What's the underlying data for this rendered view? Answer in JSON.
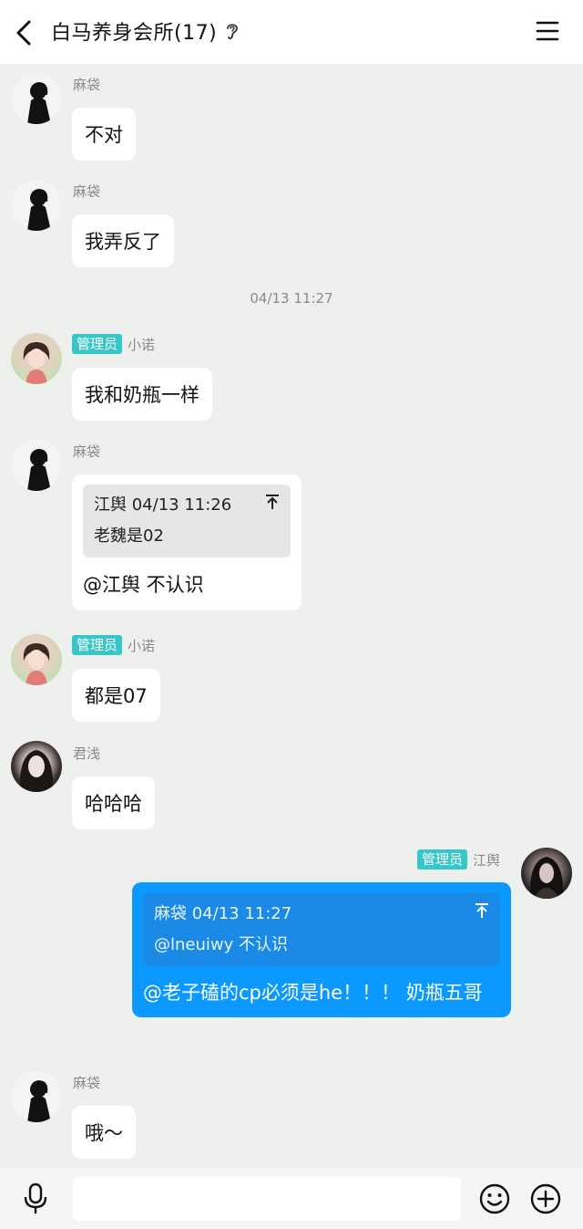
{
  "header": {
    "title": "白马养身会所(17)",
    "back_icon": "chevron-left-icon",
    "ear_icon": "ear-icon",
    "menu_icon": "hamburger-menu-icon"
  },
  "time_separator": "04/13 11:27",
  "messages": [
    {
      "sender": "麻袋",
      "text": "不对"
    },
    {
      "sender": "麻袋",
      "text": "我弄反了"
    },
    {
      "badge": "管理员",
      "sender": "小诺",
      "text": "我和奶瓶一样"
    },
    {
      "sender": "麻袋",
      "quote": {
        "head": "江舆 04/13 11:26",
        "body": "老魏是02",
        "arrow": "⬆"
      },
      "text": "@江舆 不认识"
    },
    {
      "badge": "管理员",
      "sender": "小诺",
      "text": "都是07"
    },
    {
      "sender": "君浅",
      "text": "哈哈哈"
    },
    {
      "badge": "管理员",
      "sender": "江舆",
      "quote": {
        "head": "麻袋 04/13 11:27",
        "body": "@lneuiwy 不认识",
        "arrow": "⬆"
      },
      "text": "@老子磕的cp必须是he！！！ 奶瓶五哥"
    },
    {
      "sender": "麻袋",
      "text": "哦～"
    }
  ],
  "input_bar": {
    "mic_icon": "microphone-icon",
    "emoji_icon": "smiley-icon",
    "plus_icon": "plus-circle-icon",
    "placeholder": ""
  },
  "colors": {
    "background": "#edf0ec",
    "self_bubble": "#0b99ff",
    "admin_badge": "#37c7c8"
  }
}
